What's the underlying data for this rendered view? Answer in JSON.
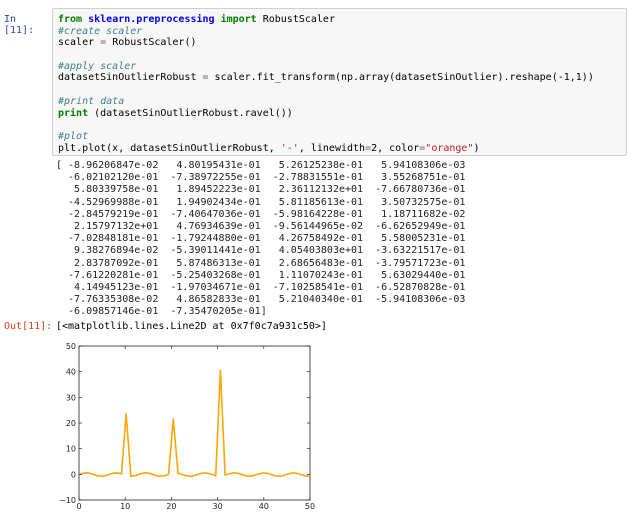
{
  "cell_in": {
    "prompt": "In [11]:",
    "code": [
      [
        [
          "kw",
          "from "
        ],
        [
          "mod",
          "sklearn.preprocessing "
        ],
        [
          "kw",
          "import "
        ],
        [
          "",
          "RobustScaler"
        ]
      ],
      [
        [
          "cm",
          "#create scaler"
        ]
      ],
      [
        [
          "",
          "scaler "
        ],
        [
          "op",
          "= "
        ],
        [
          "",
          "RobustScaler()"
        ]
      ],
      [],
      [
        [
          "cm",
          "#apply scaler"
        ]
      ],
      [
        [
          "",
          "datasetSinOutlierRobust "
        ],
        [
          "op",
          "= "
        ],
        [
          "",
          "scaler.fit_transform(np.array(datasetSinOutlier).reshape(-1,1))"
        ]
      ],
      [],
      [
        [
          "cm",
          "#print data"
        ]
      ],
      [
        [
          "kw",
          "print "
        ],
        [
          "",
          "(datasetSinOutlierRobust.ravel())"
        ]
      ],
      [],
      [
        [
          "cm",
          "#plot"
        ]
      ],
      [
        [
          "",
          "plt.plot(x, datasetSinOutlierRobust, "
        ],
        [
          "st",
          "'-'"
        ],
        [
          "",
          ", linewidth"
        ],
        [
          "op",
          "="
        ],
        [
          "",
          "2, color"
        ],
        [
          "op",
          "="
        ],
        [
          "st",
          "\"orange\""
        ],
        [
          "",
          ")"
        ]
      ]
    ]
  },
  "stdout": "[ -8.96206847e-02   4.80195431e-01   5.26125238e-01   5.94108306e-03\n  -6.02102120e-01  -7.38972255e-01  -2.78831551e-01   3.55268751e-01\n   5.80339758e-01   1.89452223e-01   2.36112132e+01  -7.66780736e-01\n  -4.52969988e-01   1.94902434e-01   5.81185613e-01   3.50732575e-01\n  -2.84579219e-01  -7.40647036e-01  -5.98164228e-01   1.18711682e-02\n   2.15797132e+01   4.76934639e-01  -9.56144965e-02  -6.62652949e-01\n  -7.02848181e-01  -1.79244880e-01   4.26758492e-01   5.58005231e-01\n   9.38276894e-02  -5.39011441e-01   4.05403803e+01  -3.63221517e-01\n   2.83787092e-01   5.87486313e-01   2.68656483e-01  -3.79571723e-01\n  -7.61220281e-01  -5.25403268e-01   1.11070243e-01   5.63029440e-01\n   4.14945123e-01  -1.97034671e-01  -7.10258541e-01  -6.52870828e-01\n  -7.76335308e-02   4.86582833e-01   5.21040340e-01  -5.94108306e-03\n  -6.09857146e-01  -7.35470205e-01]",
  "cell_out": {
    "prompt": "Out[11]:",
    "result": "[<matplotlib.lines.Line2D at 0x7f0c7a931c50>]"
  },
  "chart_data": {
    "type": "line",
    "color": "#ffa500",
    "xlim": [
      0,
      50
    ],
    "ylim": [
      -10,
      50
    ],
    "xticks": [
      "0",
      "10",
      "20",
      "30",
      "40",
      "50"
    ],
    "yticks": [
      "−10",
      "0",
      "10",
      "20",
      "30",
      "40",
      "50"
    ],
    "x_range": [
      0,
      50
    ],
    "y": [
      -0.0896206847,
      0.480195431,
      0.526125238,
      0.00594108306,
      -0.60210212,
      -0.738972255,
      -0.278831551,
      0.355268751,
      0.580339758,
      0.189452223,
      23.6112132,
      -0.766780736,
      -0.452969988,
      0.194902434,
      0.581185613,
      0.350732575,
      -0.284579219,
      -0.740647036,
      -0.598164228,
      0.0118711682,
      21.5797132,
      0.476934639,
      -0.0956144965,
      -0.662652949,
      -0.702848181,
      -0.17924488,
      0.426758492,
      0.558005231,
      0.0938276894,
      -0.539011441,
      40.5403803,
      -0.363221517,
      0.283787092,
      0.587486313,
      0.268656483,
      -0.379571723,
      -0.761220281,
      -0.525403268,
      0.111070243,
      0.56302944,
      0.414945123,
      -0.197034671,
      -0.710258541,
      -0.652870828,
      -0.0776335308,
      0.486582833,
      0.52104034,
      -0.00594108306,
      -0.609857146,
      -0.735470205
    ]
  }
}
